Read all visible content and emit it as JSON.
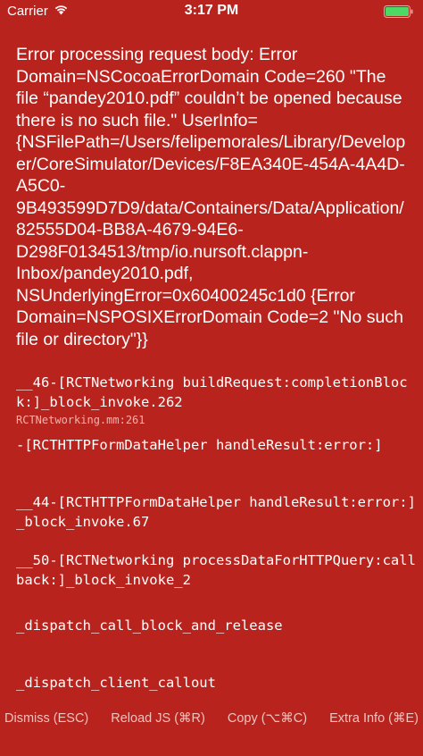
{
  "status_bar": {
    "carrier": "Carrier",
    "time": "3:17 PM",
    "wifi_icon": "wifi-icon",
    "battery_icon": "battery-icon"
  },
  "error": {
    "message": "Error processing request body: Error Domain=NSCocoaErrorDomain Code=260 \"The file “pandey2010.pdf” couldn’t be opened because there is no such file.\" UserInfo={NSFilePath=/Users/felipemorales/Library/Developer/CoreSimulator/Devices/F8EA340E-454A-4A4D-A5C0-9B493599D7D9/data/Containers/Data/Application/82555D04-BB8A-4679-94E6-D298F0134513/tmp/io.nursoft.clappn-Inbox/pandey2010.pdf, NSUnderlyingError=0x60400245c1d0 {Error Domain=NSPOSIXErrorDomain Code=2 \"No such file or directory\"}}"
  },
  "stack": [
    {
      "method": "__46-[RCTNetworking buildRequest:completionBlock:]_block_invoke.262",
      "file": "RCTNetworking.mm:261"
    },
    {
      "method": "-[RCTHTTPFormDataHelper handleResult:error:]",
      "file": ""
    },
    {
      "method": "__44-[RCTHTTPFormDataHelper handleResult:error:]_block_invoke.67",
      "file": ""
    },
    {
      "method": "__50-[RCTNetworking processDataForHTTPQuery:callback:]_block_invoke_2",
      "file": ""
    },
    {
      "method": "_dispatch_call_block_and_release",
      "file": ""
    },
    {
      "method": "_dispatch_client_callout",
      "file": ""
    }
  ],
  "footer": {
    "dismiss": "Dismiss (ESC)",
    "reload": "Reload JS (⌘R)",
    "copy": "Copy (⌥⌘C)",
    "extra": "Extra Info (⌘E)"
  },
  "colors": {
    "background": "#b9231d",
    "text": "#ffffff",
    "file_text": "#f2b3ae",
    "footer_text": "#efc3bf",
    "battery_fill": "#4cd964"
  }
}
